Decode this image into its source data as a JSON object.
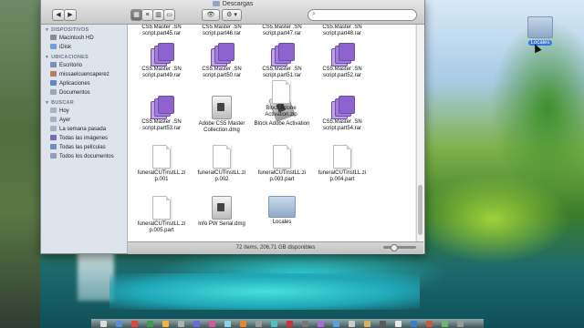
{
  "window": {
    "title": "Descargas",
    "status": "72 ítems, 206,71 GB disponibles",
    "search_placeholder": ""
  },
  "toolbar": {
    "back_label": "◀",
    "forward_label": "▶",
    "eye_label": "👁",
    "gear_label": "⚙ ▾"
  },
  "sidebar": {
    "sections": [
      {
        "title": "DISPOSITIVOS",
        "items": [
          "Macintosh HD",
          "iDisk"
        ]
      },
      {
        "title": "UBICACIONES",
        "items": [
          "Escritorio",
          "missaelcuencaperez",
          "Aplicaciones",
          "Documentos"
        ]
      },
      {
        "title": "BUSCAR",
        "items": [
          "Hoy",
          "Ayer",
          "La semana pasada",
          "Todas las imágenes",
          "Todas las películas",
          "Todos los documentos"
        ]
      }
    ]
  },
  "files": [
    {
      "name": "CS5.Master .SN script.part45.rar",
      "type": "rar"
    },
    {
      "name": "CS5.Master .SN script.part46.rar",
      "type": "rar"
    },
    {
      "name": "CS5.Master .SN script.part47.rar",
      "type": "rar"
    },
    {
      "name": "CS5.Master .SN script.part48.rar",
      "type": "rar"
    },
    {
      "name": "CS5.Master .SN script.part49.rar",
      "type": "rar"
    },
    {
      "name": "CS5.Master .SN script.part50.rar",
      "type": "rar"
    },
    {
      "name": "CS5.Master .SN script.part51.rar",
      "type": "rar"
    },
    {
      "name": "CS5.Master .SN script.part52.rar",
      "type": "rar"
    },
    {
      "name": "CS5.Master .SN script.part53.rar",
      "type": "rar"
    },
    {
      "name": "Adobe CS5 Master Collection.dmg",
      "type": "dmg"
    },
    {
      "name": "Block Adobe Activation",
      "type": "app"
    },
    {
      "name": "CS5.Master .SN script.part54.rar",
      "type": "rar"
    },
    {
      "name": "funeralCUTinstLL.zi p.001",
      "type": "doc"
    },
    {
      "name": "funeralCUTinstLL.zi p.002",
      "type": "doc"
    },
    {
      "name": "funeralCUTinstLL.zi p.003.part",
      "type": "doc"
    },
    {
      "name": "funeralCUTinstLL.zi p.004.part",
      "type": "doc"
    },
    {
      "name": "funeralCUTinstLL.zi p.005.part",
      "type": "doc"
    },
    {
      "name": "Info PW Serial.dmg",
      "type": "dmg"
    },
    {
      "name": "Locales",
      "type": "folder"
    }
  ],
  "drag_item": {
    "name": "Block Adobe Activation.zip"
  },
  "desktop_folder": {
    "name": "Locales"
  },
  "colors": {
    "accent": "#3875d7",
    "rar_purple": "#9b6bd3",
    "rar_lavender": "#c3a3e8"
  }
}
